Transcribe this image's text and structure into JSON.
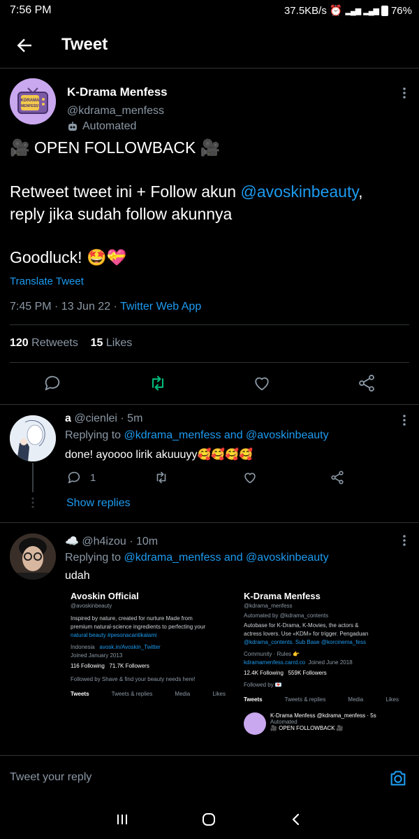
{
  "status_bar": {
    "time": "7:56 PM",
    "speed": "37.5KB/s",
    "battery": "76%"
  },
  "header": {
    "title": "Tweet"
  },
  "tweet": {
    "name": "K-Drama Menfess",
    "handle": "@kdrama_menfess",
    "automated_label": "Automated",
    "avatar_text": "KDRAMA MENFESS!",
    "line1": "🎥 OPEN FOLLOWBACK 🎥",
    "line2_prefix": "Retweet tweet ini + Follow akun ",
    "line2_mention": "@avoskinbeauty",
    "line2_suffix": ",",
    "line3": "reply jika sudah follow akunnya",
    "line4": "Goodluck! 🤩💝",
    "translate": "Translate Tweet",
    "timestamp": "7:45 PM · 13 Jun 22 · ",
    "source": "Twitter Web App",
    "retweets_count": "120",
    "retweets_label": "Retweets",
    "likes_count": "15",
    "likes_label": "Likes"
  },
  "replies": [
    {
      "name": "a",
      "handle_time": "@cienlei · 5m",
      "replying_prefix": "Replying to ",
      "replying_to": "@kdrama_menfess and @avoskinbeauty",
      "text": "done! ayoooo lirik akuuuyy🥰🥰🥰🥰",
      "reply_count": "1",
      "show_replies": "Show replies"
    },
    {
      "name": "☁️",
      "handle_time": "@h4izou · 10m",
      "replying_prefix": "Replying to ",
      "replying_to": "@kdrama_menfess and @avoskinbeauty",
      "text": "udah"
    }
  ],
  "embed": {
    "left": {
      "name": "Avoskin Official",
      "handle": "@avoskinbeauty",
      "bio1": "Inspired by nature, created for nurture Made from",
      "bio2": "premium natural-science ingredients to perfecting your",
      "bio3": "natural beauty #pesonacantikalami",
      "location": "Indonesia",
      "link": "avosk.in/Avoskin_Twitter",
      "joined": "Joined January 2013",
      "following": "116 Following",
      "followers": "71.7K Followers",
      "followed_by": "Followed by Shave & find your beauty needs here!",
      "tabs": [
        "Tweets",
        "Tweets & replies",
        "Media",
        "Likes"
      ]
    },
    "right": {
      "name": "K-Drama Menfess",
      "handle": "@kdrama_menfess",
      "automated": "Automated by @kdrama_contents",
      "bio1": "Autobase for K-Drama, K-Movies, the actors &",
      "bio2": "actress lovers. Use «KDM» for trigger. Pengaduan",
      "bio3": "@kdrama_contents. Sub Base @korcinema_fess",
      "community": "Community · Rules 👉",
      "link": "kdramamenfess.carrd.co",
      "joined": "Joined June 2018",
      "following": "12.4K Following",
      "followers": "559K Followers",
      "followed_by": "Followed by 💌",
      "tabs": [
        "Tweets",
        "Tweets & replies",
        "Media",
        "Likes"
      ],
      "mini_tweet_head": "K-Drama Menfess @kdrama_menfess · 5s",
      "mini_automated": "Automated",
      "mini_text": "🎥 OPEN FOLLOWBACK 🎥"
    }
  },
  "composer": {
    "placeholder": "Tweet your reply"
  },
  "colors": {
    "accent": "#1d9bf0",
    "retweet": "#00ba7c",
    "background": "#000000"
  }
}
